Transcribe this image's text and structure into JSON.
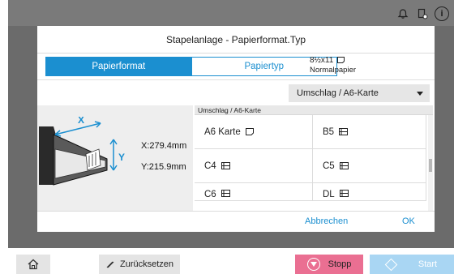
{
  "dialog": {
    "title": "Stapelanlage - Papierformat.Typ",
    "tabs": [
      {
        "label": "Papierformat",
        "active": true
      },
      {
        "label": "Papiertyp",
        "active": false
      }
    ],
    "paper_info": {
      "size": "8½x11",
      "type": "Normalpapier"
    },
    "dropdown": {
      "value": "Umschlag / A6-Karte"
    },
    "dimensions": {
      "x": "X:279.4mm",
      "y": "Y:215.9mm"
    },
    "illustration_labels": {
      "x": "X",
      "y": "Y"
    },
    "list": {
      "header": "Umschlag / A6-Karte",
      "items": [
        {
          "label": "A6  Karte",
          "icon": "portrait-page-icon"
        },
        {
          "label": "B5",
          "icon": "envelope-icon"
        },
        {
          "label": "C4",
          "icon": "envelope-icon"
        },
        {
          "label": "C5",
          "icon": "envelope-icon"
        },
        {
          "label": "C6",
          "icon": "envelope-icon"
        },
        {
          "label": "DL",
          "icon": "envelope-icon"
        }
      ]
    },
    "buttons": {
      "cancel": "Abbrechen",
      "ok": "OK"
    }
  },
  "bottom_bar": {
    "reset": "Zurücksetzen",
    "stop": "Stopp",
    "start": "Start"
  },
  "colors": {
    "accent": "#1b8fd0",
    "stop": "#ea6f92",
    "start": "#a9d6f3",
    "background": "#6b6b6b"
  }
}
